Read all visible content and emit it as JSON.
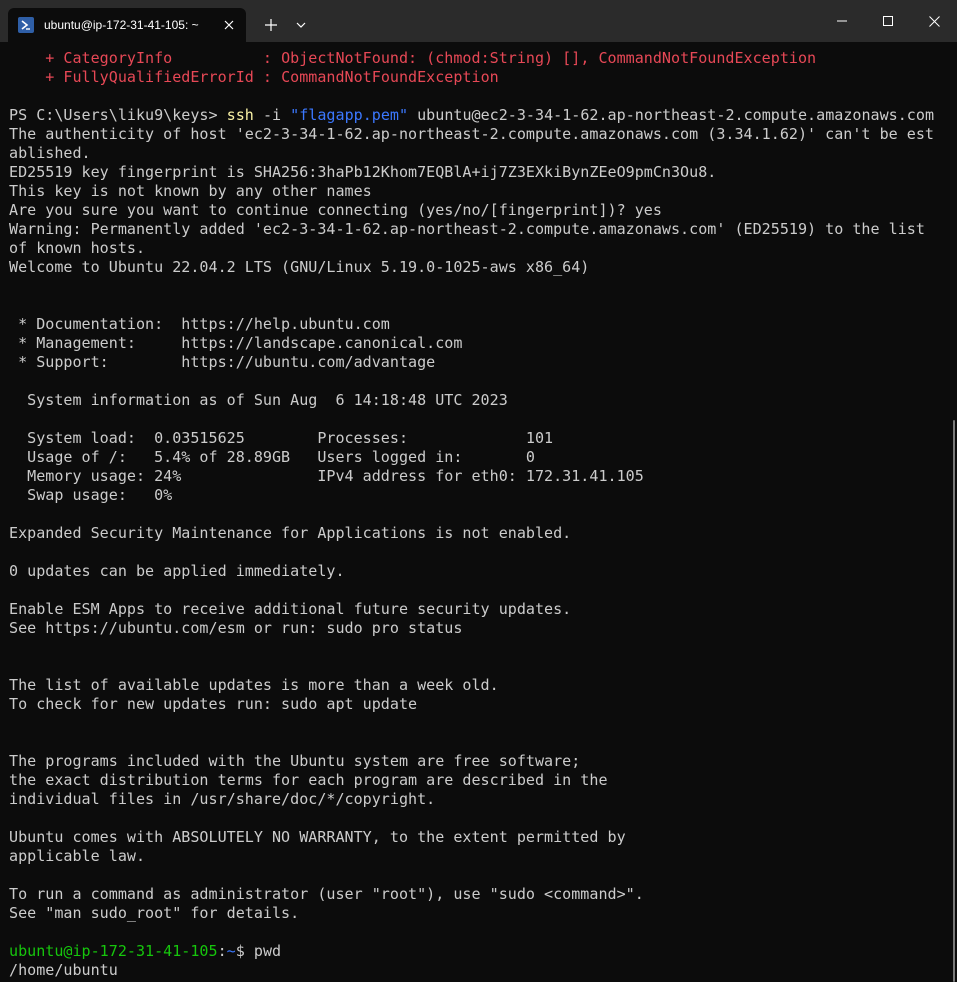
{
  "tab": {
    "title": "ubuntu@ip-172-31-41-105: ~",
    "icon": "powershell-icon"
  },
  "toolbar": {
    "new_tab_label": "+",
    "dropdown_icon": "chevron-down-icon"
  },
  "window": {
    "minimize_icon": "minimize-icon",
    "maximize_icon": "maximize-icon",
    "close_icon": "close-icon"
  },
  "terminal": {
    "err1_label": "    + CategoryInfo          : ",
    "err1_value": "ObjectNotFound: (chmod:String) [], CommandNotFoundException",
    "err2_label": "    + FullyQualifiedErrorId : ",
    "err2_value": "CommandNotFoundException",
    "ps_prompt": "PS C:\\Users\\liku9\\keys> ",
    "ps_cmd": "ssh",
    "ps_flag": " -i ",
    "ps_key": "\"flagapp.pem\"",
    "ps_rest": " ubuntu@ec2-3-34-1-62.ap-northeast-2.compute.amazonaws.com",
    "l01": "The authenticity of host 'ec2-3-34-1-62.ap-northeast-2.compute.amazonaws.com (3.34.1.62)' can't be est",
    "l02": "ablished.",
    "l03": "ED25519 key fingerprint is SHA256:3haPb12Khom7EQBlA+ij7Z3EXkiBynZEeO9pmCn3Ou8.",
    "l04": "This key is not known by any other names",
    "l05": "Are you sure you want to continue connecting (yes/no/[fingerprint])? yes",
    "l06": "Warning: Permanently added 'ec2-3-34-1-62.ap-northeast-2.compute.amazonaws.com' (ED25519) to the list",
    "l07": "of known hosts.",
    "l08": "Welcome to Ubuntu 22.04.2 LTS (GNU/Linux 5.19.0-1025-aws x86_64)",
    "l09": " * Documentation:  https://help.ubuntu.com",
    "l10": " * Management:     https://landscape.canonical.com",
    "l11": " * Support:        https://ubuntu.com/advantage",
    "l12": "  System information as of Sun Aug  6 14:18:48 UTC 2023",
    "l13": "  System load:  0.03515625        Processes:             101",
    "l14": "  Usage of /:   5.4% of 28.89GB   Users logged in:       0",
    "l15": "  Memory usage: 24%               IPv4 address for eth0: 172.31.41.105",
    "l16": "  Swap usage:   0%",
    "l17": "Expanded Security Maintenance for Applications is not enabled.",
    "l18": "0 updates can be applied immediately.",
    "l19": "Enable ESM Apps to receive additional future security updates.",
    "l20": "See https://ubuntu.com/esm or run: sudo pro status",
    "l21": "The list of available updates is more than a week old.",
    "l22": "To check for new updates run: sudo apt update",
    "l23": "The programs included with the Ubuntu system are free software;",
    "l24": "the exact distribution terms for each program are described in the",
    "l25": "individual files in /usr/share/doc/*/copyright.",
    "l26": "Ubuntu comes with ABSOLUTELY NO WARRANTY, to the extent permitted by",
    "l27": "applicable law.",
    "l28": "To run a command as administrator (user \"root\"), use \"sudo <command>\".",
    "l29": "See \"man sudo_root\" for details.",
    "bash_user": "ubuntu@ip-172-31-41-105",
    "bash_sep": ":",
    "bash_dir": "~",
    "bash_rest": "$ pwd",
    "output": "/home/ubuntu"
  },
  "colors": {
    "background": "#0c0c0c",
    "text": "#cccccc",
    "error": "#e74856",
    "command": "#f9f1a5",
    "string": "#3b78ff",
    "prompt_user": "#16c60c",
    "prompt_dir": "#3b78ff"
  }
}
